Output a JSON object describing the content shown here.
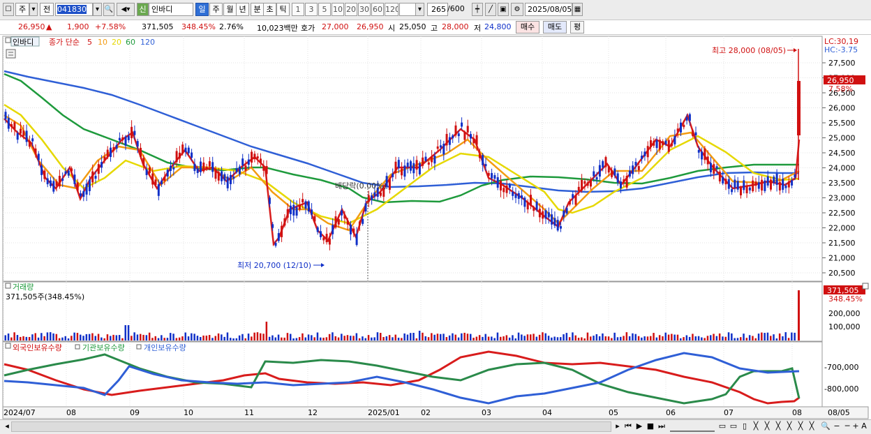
{
  "toolbar": {
    "market": "주",
    "compare": "전",
    "code": "041830",
    "shin_badge": "신",
    "stock_name": "인바디",
    "periods": [
      "일",
      "주",
      "월",
      "년",
      "분",
      "초",
      "틱"
    ],
    "selected_period": "일",
    "minute_options": [
      "1",
      "3",
      "5",
      "10",
      "20",
      "30",
      "60",
      "120"
    ],
    "count": "265",
    "count_total": "/600",
    "date": "2025/08/05"
  },
  "infobar": {
    "price": "26,950",
    "arrow": "▲",
    "change": "1,900",
    "change_pct": "+7.58%",
    "volume": "371,505",
    "volume_ratio": "348.45%",
    "turnover": "2.76%",
    "amount": "10,023백만",
    "ask_label": "호가",
    "ask": "27,000",
    "bid": "26,950",
    "open_label": "시",
    "open": "25,050",
    "high_label": "고",
    "high": "28,000",
    "low_label": "저",
    "low": "24,800",
    "buy_btn": "매수",
    "sell_btn": "매도",
    "eval_btn": "평"
  },
  "price_panel": {
    "name_tag": "인바디",
    "legend_prefix": "종가 단순",
    "ma": [
      {
        "label": "5",
        "color": "#e02020"
      },
      {
        "label": "10",
        "color": "#f39c12"
      },
      {
        "label": "20",
        "color": "#e6d800"
      },
      {
        "label": "60",
        "color": "#1e9a3c"
      },
      {
        "label": "120",
        "color": "#2f5fd6"
      }
    ],
    "lc": "LC:30,19",
    "hc": "HC:-3.75",
    "y_ticks": [
      "27,500",
      "27,000",
      "26,500",
      "26,000",
      "25,500",
      "25,000",
      "24,500",
      "24,000",
      "23,500",
      "23,000",
      "22,500",
      "22,000",
      "21,500",
      "21,000",
      "20,500"
    ],
    "price_tag": "26,950",
    "price_tag_pct": "7.58%",
    "high_annotation": "최고 28,000 (08/05)",
    "low_annotation": "최저 20,700 (12/10)",
    "dividend_label": "배당락(0.00%)"
  },
  "volume_panel": {
    "title": "거래량",
    "value": "371,505주(348.45%)",
    "y_ticks": [
      "200,000",
      "100,000"
    ],
    "tag_value": "371,505",
    "tag_pct": "348.45%"
  },
  "holdings_panel": {
    "legend": [
      {
        "label": "외국인보유수량",
        "color": "#d01010"
      },
      {
        "label": "기관보유수량",
        "color": "#1e9a3c"
      },
      {
        "label": "개인보유수량",
        "color": "#2f5fd6"
      }
    ],
    "y_ticks": [
      "-700,000",
      "-800,000"
    ]
  },
  "x_axis": {
    "labels": [
      "2024/07",
      "08",
      "09",
      "10",
      "11",
      "12",
      "2025/01",
      "02",
      "03",
      "04",
      "05",
      "06",
      "07",
      "08"
    ],
    "right_label": "08/05"
  }
}
